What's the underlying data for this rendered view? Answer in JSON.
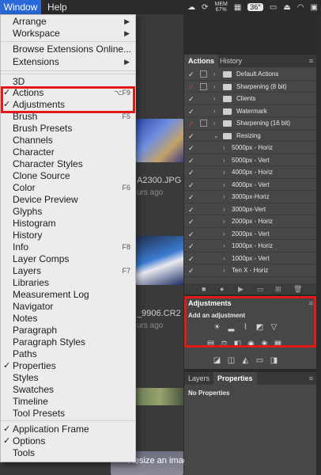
{
  "menubar": {
    "window_label": "Window",
    "help_label": "Help",
    "memory_label": "MEM",
    "memory_value": "67%",
    "temperature": "36°"
  },
  "menu": {
    "items": [
      {
        "label": "Arrange",
        "shortcut": "",
        "check": "",
        "submenu": true
      },
      {
        "label": "Workspace",
        "shortcut": "",
        "check": "",
        "submenu": true
      },
      {
        "label": "Browse Extensions Online...",
        "shortcut": "",
        "check": "",
        "submenu": false
      },
      {
        "label": "Extensions",
        "shortcut": "",
        "check": "",
        "submenu": true
      },
      {
        "label": "3D",
        "shortcut": "",
        "check": "",
        "submenu": false
      },
      {
        "label": "Actions",
        "shortcut": "⌥F9",
        "check": "✓",
        "submenu": false
      },
      {
        "label": "Adjustments",
        "shortcut": "",
        "check": "✓",
        "submenu": false
      },
      {
        "label": "Brush",
        "shortcut": "F5",
        "check": "",
        "submenu": false
      },
      {
        "label": "Brush Presets",
        "shortcut": "",
        "check": "",
        "submenu": false
      },
      {
        "label": "Channels",
        "shortcut": "",
        "check": "",
        "submenu": false
      },
      {
        "label": "Character",
        "shortcut": "",
        "check": "",
        "submenu": false
      },
      {
        "label": "Character Styles",
        "shortcut": "",
        "check": "",
        "submenu": false
      },
      {
        "label": "Clone Source",
        "shortcut": "",
        "check": "",
        "submenu": false
      },
      {
        "label": "Color",
        "shortcut": "F6",
        "check": "",
        "submenu": false
      },
      {
        "label": "Device Preview",
        "shortcut": "",
        "check": "",
        "submenu": false
      },
      {
        "label": "Glyphs",
        "shortcut": "",
        "check": "",
        "submenu": false
      },
      {
        "label": "Histogram",
        "shortcut": "",
        "check": "",
        "submenu": false
      },
      {
        "label": "History",
        "shortcut": "",
        "check": "",
        "submenu": false
      },
      {
        "label": "Info",
        "shortcut": "F8",
        "check": "",
        "submenu": false
      },
      {
        "label": "Layer Comps",
        "shortcut": "",
        "check": "",
        "submenu": false
      },
      {
        "label": "Layers",
        "shortcut": "F7",
        "check": "",
        "submenu": false
      },
      {
        "label": "Libraries",
        "shortcut": "",
        "check": "",
        "submenu": false
      },
      {
        "label": "Measurement Log",
        "shortcut": "",
        "check": "",
        "submenu": false
      },
      {
        "label": "Navigator",
        "shortcut": "",
        "check": "",
        "submenu": false
      },
      {
        "label": "Notes",
        "shortcut": "",
        "check": "",
        "submenu": false
      },
      {
        "label": "Paragraph",
        "shortcut": "",
        "check": "",
        "submenu": false
      },
      {
        "label": "Paragraph Styles",
        "shortcut": "",
        "check": "",
        "submenu": false
      },
      {
        "label": "Paths",
        "shortcut": "",
        "check": "",
        "submenu": false
      },
      {
        "label": "Properties",
        "shortcut": "",
        "check": "✓",
        "submenu": false
      },
      {
        "label": "Styles",
        "shortcut": "",
        "check": "",
        "submenu": false
      },
      {
        "label": "Swatches",
        "shortcut": "",
        "check": "",
        "submenu": false
      },
      {
        "label": "Timeline",
        "shortcut": "",
        "check": "",
        "submenu": false
      },
      {
        "label": "Tool Presets",
        "shortcut": "",
        "check": "",
        "submenu": false
      },
      {
        "label": "Application Frame",
        "shortcut": "",
        "check": "✓",
        "submenu": false
      },
      {
        "label": "Options",
        "shortcut": "",
        "check": "✓",
        "submenu": false
      },
      {
        "label": "Tools",
        "shortcut": "",
        "check": "",
        "submenu": false
      }
    ]
  },
  "actions_panel": {
    "tab_actions": "Actions",
    "tab_history": "History",
    "rows": [
      {
        "label": "Default Actions",
        "check_color": "white",
        "has_box": true,
        "indent": 0
      },
      {
        "label": "Sharpening (8 bit)",
        "check_color": "red",
        "has_box": true,
        "indent": 0
      },
      {
        "label": "Clients",
        "check_color": "white",
        "has_box": false,
        "indent": 0
      },
      {
        "label": "Watermark",
        "check_color": "white",
        "has_box": false,
        "indent": 0
      },
      {
        "label": "Sharpening (16 bit)",
        "check_color": "red",
        "has_box": true,
        "indent": 0
      },
      {
        "label": "Resizing",
        "check_color": "white",
        "has_box": false,
        "indent": 0
      },
      {
        "label": "5000px - Horiz",
        "check_color": "white",
        "has_box": false,
        "indent": 1
      },
      {
        "label": "5000px - Vert",
        "check_color": "white",
        "has_box": false,
        "indent": 1
      },
      {
        "label": "4000px - Horiz",
        "check_color": "white",
        "has_box": false,
        "indent": 1
      },
      {
        "label": "4000px - Vert",
        "check_color": "white",
        "has_box": false,
        "indent": 1
      },
      {
        "label": "3000px-Horiz",
        "check_color": "white",
        "has_box": false,
        "indent": 1
      },
      {
        "label": "3000px-Vert",
        "check_color": "white",
        "has_box": false,
        "indent": 1
      },
      {
        "label": "2000px - Horiz",
        "check_color": "white",
        "has_box": false,
        "indent": 1
      },
      {
        "label": "2000px - Vert",
        "check_color": "white",
        "has_box": false,
        "indent": 1
      },
      {
        "label": "1000px - Horiz",
        "check_color": "white",
        "has_box": false,
        "indent": 1
      },
      {
        "label": "1000px - Vert",
        "check_color": "white",
        "has_box": false,
        "indent": 1
      },
      {
        "label": "Ten X - Horiz",
        "check_color": "white",
        "has_box": false,
        "indent": 1
      }
    ]
  },
  "adjustments_panel": {
    "title": "Adjustments",
    "subtitle": "Add an adjustment"
  },
  "properties_panel": {
    "tab_layers": "Layers",
    "tab_properties": "Properties",
    "empty_text": "No Properties"
  },
  "background": {
    "caption1": "A2300.JPG",
    "sub1": "urs ago",
    "caption2": "_9906.CR2",
    "sub2": "urs ago",
    "caption3": "Resize an image"
  },
  "colors": {
    "highlight_red": "#e11a1a",
    "menu_bg": "#ececec",
    "panel_bg": "#474747",
    "selected_menu_blue": "#2a6ad8"
  }
}
